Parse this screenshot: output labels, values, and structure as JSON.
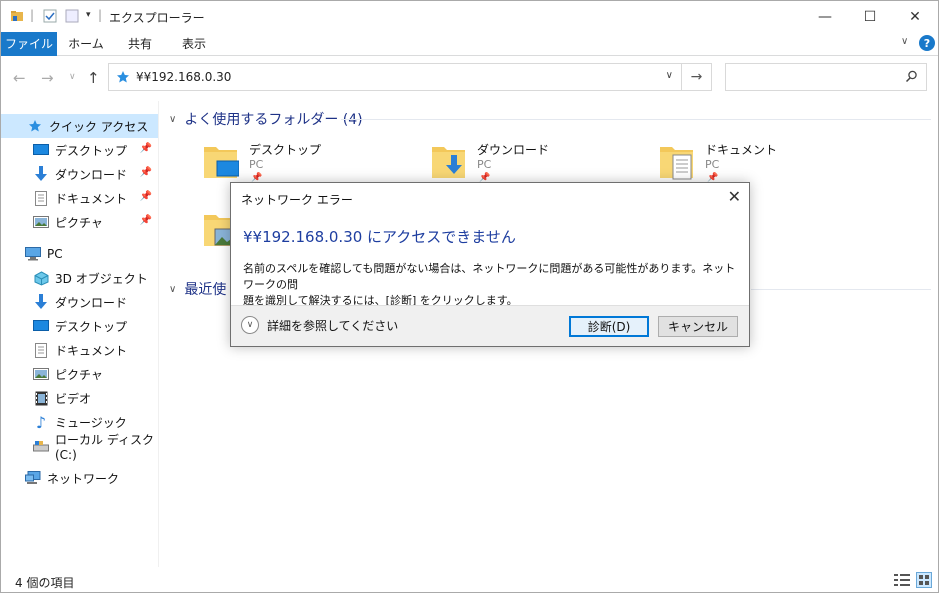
{
  "window": {
    "title": "エクスプローラー",
    "minimize": "—",
    "maximize": "☐",
    "close": "✕"
  },
  "ribbon": {
    "tabs": [
      "ファイル",
      "ホーム",
      "共有",
      "表示"
    ],
    "help": "?"
  },
  "address": {
    "path": "¥¥192.168.0.30",
    "search_placeholder": ""
  },
  "sidebar": {
    "items": [
      {
        "label": "クイック アクセス",
        "icon": "star-icon",
        "selected": true
      },
      {
        "label": "デスクトップ",
        "icon": "desktop-icon",
        "pinned": true
      },
      {
        "label": "ダウンロード",
        "icon": "download-icon",
        "pinned": true
      },
      {
        "label": "ドキュメント",
        "icon": "document-icon",
        "pinned": true
      },
      {
        "label": "ピクチャ",
        "icon": "picture-icon",
        "pinned": true
      },
      {
        "label": "PC",
        "icon": "pc-icon"
      },
      {
        "label": "3D オブジェクト",
        "icon": "cube-icon"
      },
      {
        "label": "ダウンロード",
        "icon": "download-icon"
      },
      {
        "label": "デスクトップ",
        "icon": "desktop-icon"
      },
      {
        "label": "ドキュメント",
        "icon": "document-icon"
      },
      {
        "label": "ピクチャ",
        "icon": "picture-icon"
      },
      {
        "label": "ビデオ",
        "icon": "video-icon"
      },
      {
        "label": "ミュージック",
        "icon": "music-icon"
      },
      {
        "label": "ローカル ディスク (C:)",
        "icon": "disk-icon"
      },
      {
        "label": "ネットワーク",
        "icon": "network-icon"
      }
    ]
  },
  "main": {
    "frequent_header": "よく使用するフォルダー (4)",
    "recent_header": "最近使",
    "folders": [
      {
        "name": "デスクトップ",
        "location": "PC"
      },
      {
        "name": "ダウンロード",
        "location": "PC"
      },
      {
        "name": "ドキュメント",
        "location": "PC"
      }
    ]
  },
  "status": {
    "item_count": "4 個の項目"
  },
  "dialog": {
    "title": "ネットワーク エラー",
    "heading": "¥¥192.168.0.30 にアクセスできません",
    "message_line1": "名前のスペルを確認しても問題がない場合は、ネットワークに問題がある可能性があります。ネットワークの問",
    "message_line2": "題を識別して解決するには、[診断] をクリックします。",
    "details_label": "詳細を参照してください",
    "diagnose_label": "診断(D)",
    "cancel_label": "キャンセル"
  },
  "colors": {
    "accent": "#1979ca",
    "heading_blue": "#1e3ea0",
    "selection": "#cce8ff"
  }
}
